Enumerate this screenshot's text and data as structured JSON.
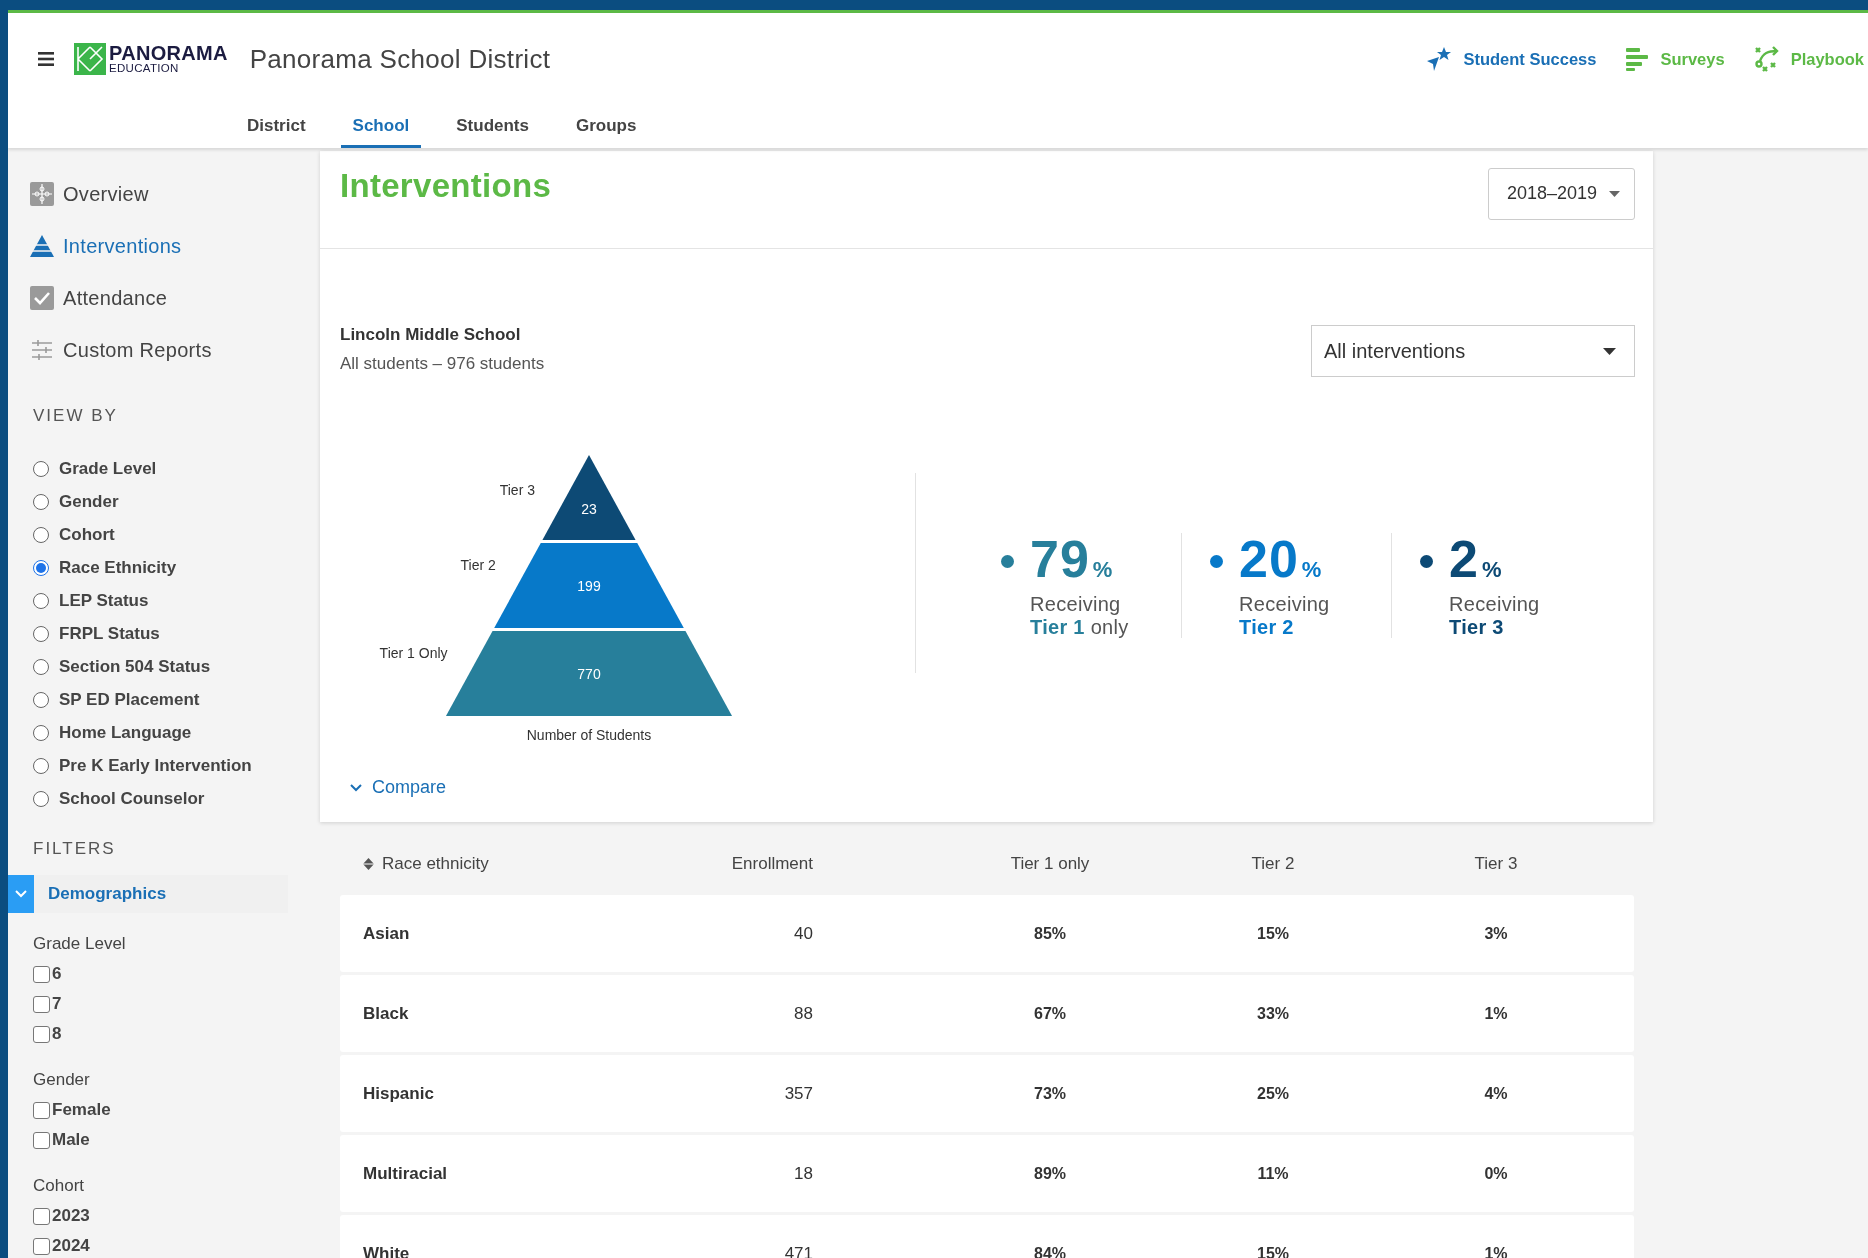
{
  "header": {
    "brand": "PANORAMA",
    "brand_sub": "EDUCATION",
    "district": "Panorama School District",
    "tabs": [
      {
        "label": "District",
        "selected": false
      },
      {
        "label": "School",
        "selected": true
      },
      {
        "label": "Students",
        "selected": false
      },
      {
        "label": "Groups",
        "selected": false
      }
    ],
    "apps": [
      {
        "kind": "star",
        "label": "Student Success",
        "color": "#1a6fb5"
      },
      {
        "kind": "bars",
        "label": "Surveys",
        "color": "#5cb946"
      },
      {
        "kind": "play",
        "label": "Playbook",
        "color": "#5cb946"
      }
    ]
  },
  "sidebar": {
    "nav": [
      {
        "kind": "puzzle",
        "label": "Overview",
        "selected": false
      },
      {
        "kind": "pyramid",
        "label": "Interventions",
        "selected": true
      },
      {
        "kind": "check",
        "label": "Attendance",
        "selected": false
      },
      {
        "kind": "sliders",
        "label": "Custom Reports",
        "selected": false
      }
    ],
    "view_by": {
      "heading": "VIEW BY",
      "options": [
        {
          "label": "Grade Level",
          "selected": false
        },
        {
          "label": "Gender",
          "selected": false
        },
        {
          "label": "Cohort",
          "selected": false
        },
        {
          "label": "Race Ethnicity",
          "selected": true
        },
        {
          "label": "LEP Status",
          "selected": false
        },
        {
          "label": "FRPL Status",
          "selected": false
        },
        {
          "label": "Section 504 Status",
          "selected": false
        },
        {
          "label": "SP ED Placement",
          "selected": false
        },
        {
          "label": "Home Language",
          "selected": false
        },
        {
          "label": "Pre K Early Intervention",
          "selected": false
        },
        {
          "label": "School Counselor",
          "selected": false
        }
      ]
    },
    "filters": {
      "heading": "FILTERS",
      "section": {
        "label": "Demographics",
        "expanded": true
      },
      "groups": [
        {
          "label": "Grade Level",
          "options": [
            {
              "label": "6",
              "checked": false
            },
            {
              "label": "7",
              "checked": false
            },
            {
              "label": "8",
              "checked": false
            }
          ]
        },
        {
          "label": "Gender",
          "options": [
            {
              "label": "Female",
              "checked": false
            },
            {
              "label": "Male",
              "checked": false
            }
          ]
        },
        {
          "label": "Cohort",
          "options": [
            {
              "label": "2023",
              "checked": false
            },
            {
              "label": "2024",
              "checked": false
            }
          ]
        }
      ]
    }
  },
  "main": {
    "title": "Interventions",
    "year": "2018–2019",
    "school": "Lincoln Middle School",
    "subtitle": "All students – 976 students",
    "intervention_filter": "All interventions",
    "pyramid": {
      "tiers": [
        {
          "label": "Tier 3",
          "count": "23",
          "color": "#0d4a75"
        },
        {
          "label": "Tier 2",
          "count": "199",
          "color": "#0779c9"
        },
        {
          "label": "Tier 1 Only",
          "count": "770",
          "color": "#277f9b"
        }
      ],
      "axis_label": "Number of Students"
    },
    "stats": [
      {
        "value": "79",
        "unit": "%",
        "caption": "Receiving",
        "tier": "Tier 1",
        "suffix": "only",
        "color": "#277f9b"
      },
      {
        "value": "20",
        "unit": "%",
        "caption": "Receiving",
        "tier": "Tier 2",
        "color": "#0779c9"
      },
      {
        "value": "2",
        "unit": "%",
        "caption": "Receiving",
        "tier": "Tier 3",
        "color": "#0d4a75"
      }
    ],
    "compare": "Compare",
    "table": {
      "columns": [
        "Race ethnicity",
        "Enrollment",
        "Tier 1 only",
        "Tier 2",
        "Tier 3"
      ],
      "rows": [
        [
          "Asian",
          "40",
          "85%",
          "15%",
          "3%"
        ],
        [
          "Black",
          "88",
          "67%",
          "33%",
          "1%"
        ],
        [
          "Hispanic",
          "357",
          "73%",
          "25%",
          "4%"
        ],
        [
          "Multiracial",
          "18",
          "89%",
          "11%",
          "0%"
        ],
        [
          "White",
          "471",
          "84%",
          "15%",
          "1%"
        ]
      ]
    }
  }
}
